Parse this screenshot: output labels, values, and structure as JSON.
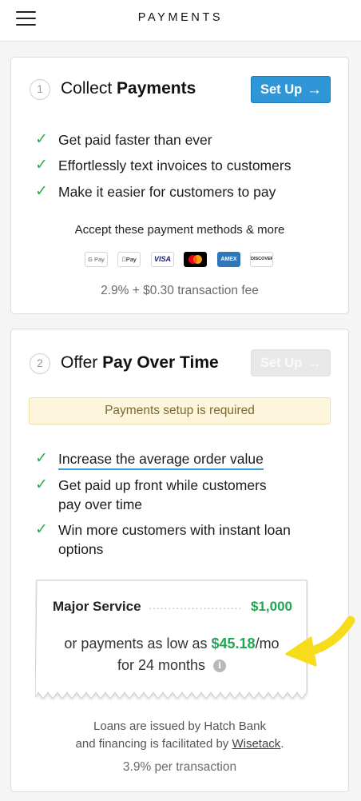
{
  "header": {
    "title": "PAYMENTS",
    "menu_icon": "hamburger-menu-icon"
  },
  "collect_card": {
    "step": "1",
    "title_prefix": "Collect ",
    "title_bold": "Payments",
    "button_label": "Set Up",
    "button_icon": "arrow-right-icon",
    "features": [
      "Get paid faster than ever",
      "Effortlessly text invoices to customers",
      "Make it easier for customers to pay"
    ],
    "accept_text": "Accept these payment methods & more",
    "payment_methods": [
      "G Pay",
      "Pay",
      "VISA",
      "Mastercard",
      "AMEX",
      "DISCOVER"
    ],
    "fee_text": "2.9% + $0.30 transaction fee"
  },
  "pay_over_time_card": {
    "step": "2",
    "title_prefix": "Offer ",
    "title_bold": "Pay Over Time",
    "button_label": "Set Up",
    "button_icon": "arrow-right-icon",
    "warning_text": "Payments setup is required",
    "features": [
      "Increase the average order value",
      "Get paid up front while customers",
      "pay over time",
      "Win more customers with instant loan",
      "options"
    ],
    "receipt": {
      "item_label": "Major Service",
      "item_dots": "..........................",
      "item_price": "$1,000",
      "payment_prefix": "or payments as low as ",
      "payment_amount": "$45.18",
      "payment_suffix": "/mo",
      "term_text": "for 24 months",
      "info_icon": "info-icon"
    },
    "disclaimer_line1": "Loans are issued by Hatch Bank",
    "disclaimer_line2_prefix": "and financing is facilitated by ",
    "disclaimer_link": "Wisetack",
    "disclaimer_line2_suffix": ".",
    "rate_text": "3.9% per transaction"
  },
  "colors": {
    "primary_button": "#2f96d8",
    "check_green": "#2fa84f",
    "price_green": "#1fa852",
    "warning_bg": "#fdf5dc",
    "arrow_yellow": "#f7dc1c"
  }
}
